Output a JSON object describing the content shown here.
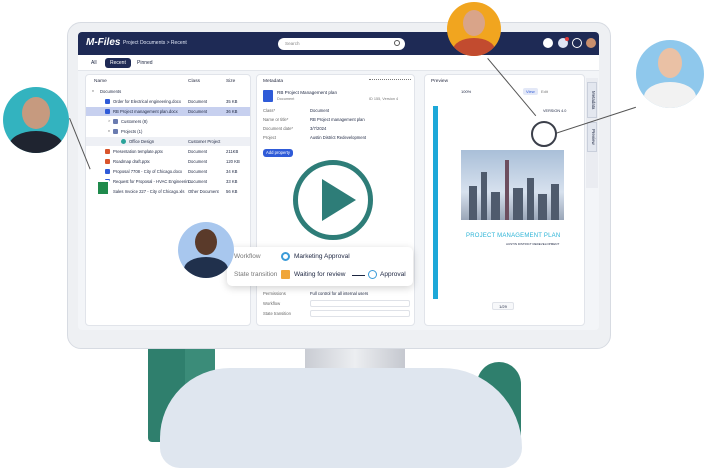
{
  "app": {
    "logo": "M-Files",
    "breadcrumb": "Project Documents > Recent",
    "search_placeholder": "Search"
  },
  "tabs": [
    {
      "label": "All"
    },
    {
      "label": "Recent"
    },
    {
      "label": "Pinned"
    }
  ],
  "list": {
    "headers": {
      "name": "Name",
      "class": "Class",
      "size": "Size"
    },
    "group": "Documents",
    "rows": [
      {
        "name": "Order for Electrical engineering.docx",
        "class": "Document",
        "size": "35 KB"
      },
      {
        "name": "RB Project management plan.docx",
        "class": "Document",
        "size": "36 KB"
      },
      {
        "name": "Customers (8)",
        "class": "",
        "size": ""
      },
      {
        "name": "Projects (1)",
        "class": "",
        "size": ""
      },
      {
        "name": "Office Design",
        "class": "Customer Project",
        "size": ""
      },
      {
        "name": "Presentation template.pptx",
        "class": "Document",
        "size": "211KB"
      },
      {
        "name": "Roadmap draft.pptx",
        "class": "Document",
        "size": "120 KB"
      },
      {
        "name": "Proposal 7708 - City of Chicago.docx",
        "class": "Document",
        "size": "34 KB"
      },
      {
        "name": "Request for Proposal - HVAC Engineerin...",
        "class": "Document",
        "size": "33 KB"
      },
      {
        "name": "Sales Invoice 227 - City of Chicago.xls",
        "class": "Other Document",
        "size": "56 KB"
      }
    ]
  },
  "metadata": {
    "title": "Metadata",
    "doc_name": "RB Project Management plan",
    "doc_type": "Document",
    "doc_id": "ID 155, Version 4",
    "fields": [
      {
        "label": "Class*",
        "value": "Document"
      },
      {
        "label": "Name or title*",
        "value": "RB Project management plan"
      },
      {
        "label": "Document date*",
        "value": "3/7/2024"
      },
      {
        "label": "Project",
        "value": "Austin District Redevelopment"
      }
    ],
    "add_property": "Add property",
    "lower_fields": [
      {
        "label": "Permissions",
        "value": "Full control for all internal users"
      },
      {
        "label": "Workflow",
        "value": ""
      },
      {
        "label": "State transition",
        "value": ""
      }
    ]
  },
  "workflow_card": {
    "workflow_label": "Workflow",
    "workflow_value": "Marketing Approval",
    "state_label": "State transition",
    "state_from": "Waiting for review",
    "state_to": "Approval"
  },
  "preview": {
    "title": "Preview",
    "zoom": "100%",
    "modes": [
      "View",
      "Edit"
    ],
    "version": "VERSION 4.0",
    "doc_title": "PROJECT MANAGEMENT PLAN",
    "doc_subtitle": "AUSTIN DISTRICT REDEVELOPMENT",
    "page": "1/29"
  },
  "side_tabs": [
    "Metadata",
    "Preview"
  ],
  "colors": {
    "nav": "#1e2a55",
    "accent": "#2f5bd8",
    "cyan": "#1da8d8",
    "play": "#2e7d78",
    "tree": "#2e7d6b"
  }
}
